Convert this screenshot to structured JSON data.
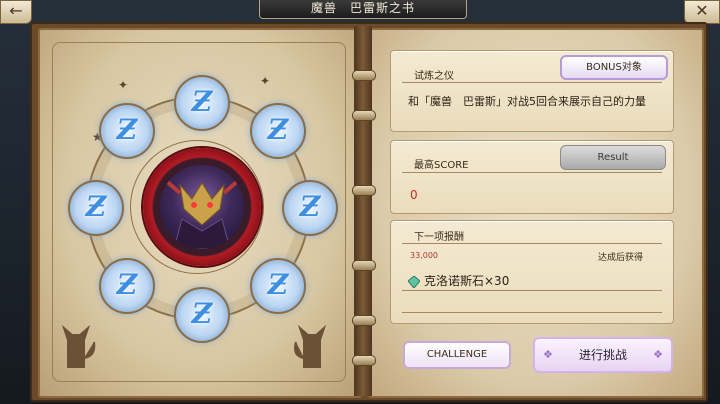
{
  "header": {
    "title": "魔兽　巴雷斯之书",
    "back_icon": "←",
    "close_icon": "✕"
  },
  "left_page": {
    "nodes": [
      "Ƶ",
      "Ƶ",
      "Ƶ",
      "Ƶ",
      "Ƶ",
      "Ƶ",
      "Ƶ",
      "Ƶ"
    ],
    "boss_name": "巴雷斯"
  },
  "trial": {
    "label": "试炼之仪",
    "bonus_button": "BONUS对象",
    "description": "和「魔兽　巴雷斯」对战5回合来展示自己的力量"
  },
  "score": {
    "label": "最高SCORE",
    "result_button": "Result",
    "value": "0"
  },
  "reward": {
    "label": "下一项报酬",
    "threshold": "33,000",
    "condition": "达成后获得",
    "item": "克洛诺斯石×30"
  },
  "actions": {
    "challenge": "CHALLENGE",
    "start": "进行挑战"
  },
  "colors": {
    "score_value": "#c0312a",
    "threshold": "#b0362e",
    "node_glow": "#3f8fe0"
  }
}
